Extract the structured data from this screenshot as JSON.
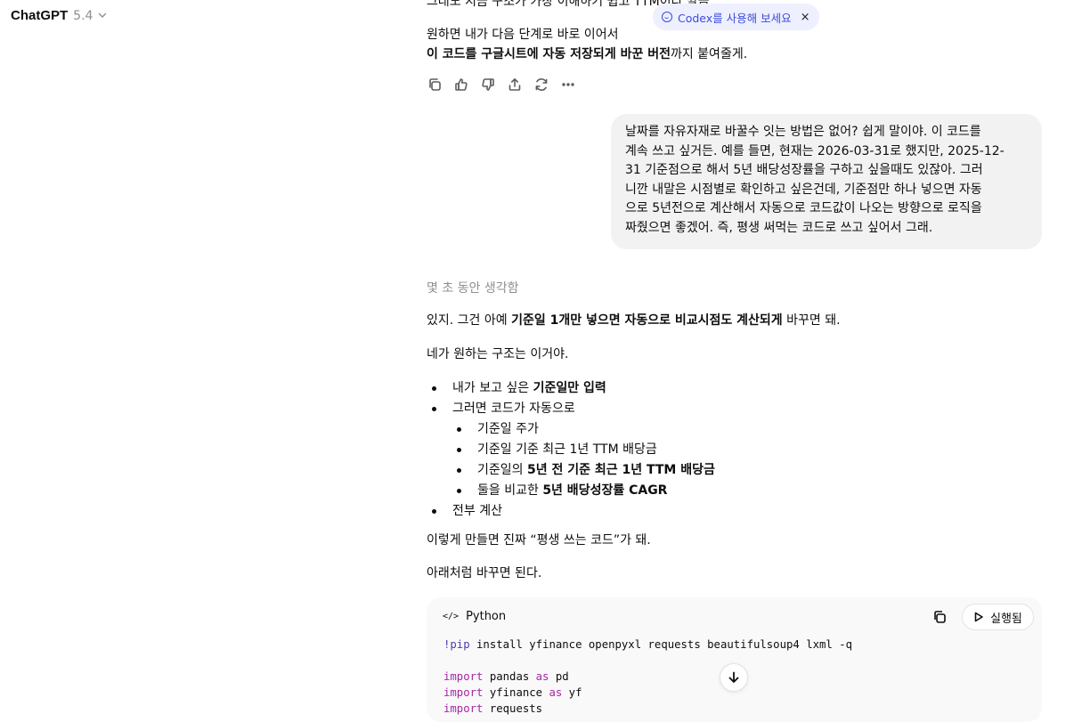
{
  "header": {
    "app_name": "ChatGPT",
    "model_version": "5.4"
  },
  "codex_banner": {
    "label": "Codex를 사용해 보세요",
    "close": "×"
  },
  "assistant_prev": {
    "cut_line": "그래도 지금 구조가 가장 이해하기 쉽고 TTM이라 깔끔",
    "line1": "원하면 내가 다음 단계로 바로 이어서",
    "line2_bold": "이 코드를 구글시트에 자동 저장되게 바꾼 버전",
    "line2_rest": "까지 붙여줄게."
  },
  "actions": [
    "copy-icon",
    "thumbs-up-icon",
    "thumbs-down-icon",
    "share-icon",
    "regenerate-icon",
    "more-icon"
  ],
  "user_message": {
    "lines": [
      "날짜를 자유자재로 바꿀수 잇는 방법은 없어? 쉽게 말이야. 이 코드를",
      "계속 쓰고 싶거든. 예를 들면, 현재는 2026-03-31로 했지만, 2025-12-",
      "31 기준점으로 해서 5년 배당성장률을 구하고 싶을때도 있잖아. 그러",
      "니깐 내말은 시점별로 확인하고 싶은건데, 기준점만 하나 넣으면 자동",
      "으로 5년전으로 계산해서 자동으로 코드값이 나오는 방향으로 로직을",
      "짜줬으면 좋겠어. 즉, 평생 써먹는 코드로 쓰고 싶어서 그래."
    ]
  },
  "assistant": {
    "thought": "몇 초 동안 생각함",
    "p1_a": "있지. 그건 아예 ",
    "p1_b": "기준일 1개만 넣으면 자동으로 비교시점도 계산되게",
    "p1_c": " 바꾸면 돼.",
    "p2": "네가 원하는 구조는 이거야.",
    "list": {
      "i1_a": "내가 보고 싶은 ",
      "i1_b": "기준일만 입력",
      "i2": "그러면 코드가 자동으로",
      "s1": "기준일 주가",
      "s2": "기준일 기준 최근 1년 TTM 배당금",
      "s3_a": "기준일의 ",
      "s3_b": "5년 전 기준 최근 1년 TTM 배당금",
      "s4_a": "둘을 비교한 ",
      "s4_b": "5년 배당성장률 CAGR",
      "i3": "전부 계산"
    },
    "p3": "이렇게 만들면 진짜 “평생 쓰는 코드”가 돼.",
    "p4": "아래처럼 바꾸면 된다."
  },
  "code_block": {
    "language": "Python",
    "run_label": "실행됨",
    "line1_bang": "!pip",
    "line1_rest": " install yfinance openpyxl requests beautifulsoup4 lxml -q",
    "kw_import": "import",
    "line3_rest": " pandas ",
    "kw_as": "as",
    "line3_alias": " pd",
    "line4_rest": " yfinance ",
    "line4_alias": " yf",
    "line5_rest": " requests"
  }
}
